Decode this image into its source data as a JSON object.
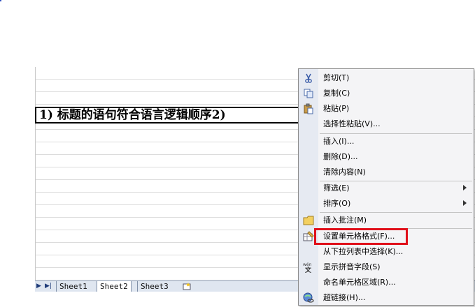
{
  "cell": {
    "text": "1)  标题的语句符合语言逻辑顺序2)"
  },
  "sheet_tabs": {
    "tabs": [
      "Sheet1",
      "Sheet2",
      "Sheet3"
    ],
    "active": "Sheet2"
  },
  "context_menu": {
    "items": [
      {
        "label": "剪切(T)",
        "icon": "scissors-icon"
      },
      {
        "label": "复制(C)",
        "icon": "copy-icon"
      },
      {
        "label": "粘贴(P)",
        "icon": "paste-icon"
      },
      {
        "label": "选择性粘贴(V)...",
        "icon": ""
      },
      {
        "label": "插入(I)...",
        "icon": ""
      },
      {
        "label": "删除(D)...",
        "icon": ""
      },
      {
        "label": "清除内容(N)",
        "icon": ""
      },
      {
        "label": "筛选(E)",
        "icon": "",
        "submenu": true
      },
      {
        "label": "排序(O)",
        "icon": "",
        "submenu": true
      },
      {
        "label": "插入批注(M)",
        "icon": "comment-icon"
      },
      {
        "label": "设置单元格格式(F)...",
        "icon": "format-cells-icon",
        "highlighted": true
      },
      {
        "label": "从下拉列表中选择(K)...",
        "icon": ""
      },
      {
        "label": "显示拼音字段(S)",
        "icon": "phonetic-icon"
      },
      {
        "label": "命名单元格区域(R)...",
        "icon": ""
      },
      {
        "label": "超链接(H)...",
        "icon": "hyperlink-icon"
      }
    ],
    "highlight_color": "#e0101a"
  }
}
